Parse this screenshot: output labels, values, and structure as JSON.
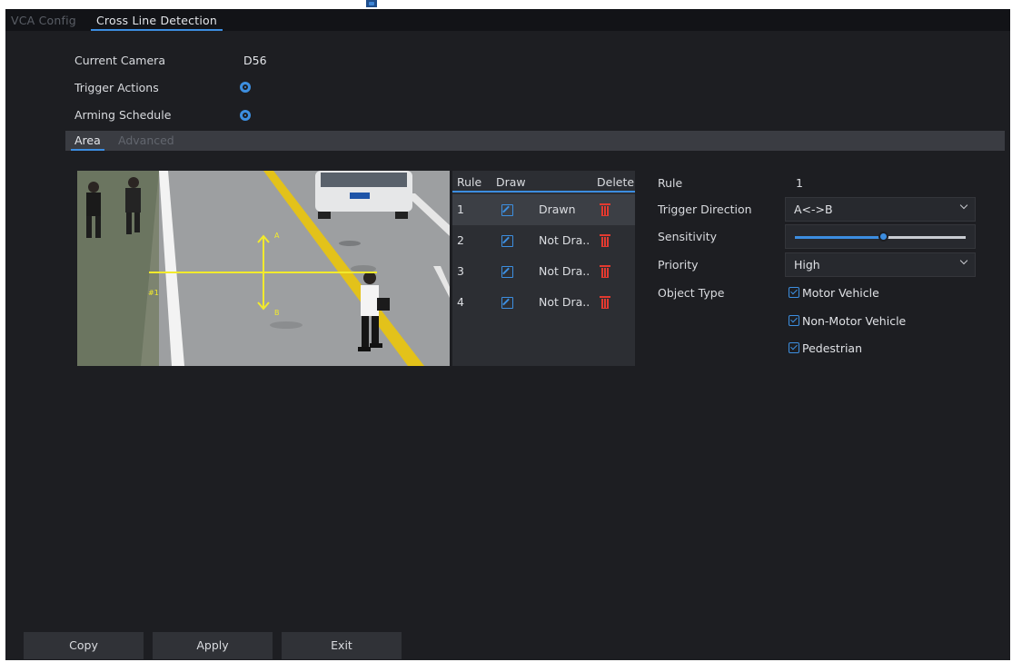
{
  "main_tabs": [
    {
      "label": "VCA Config",
      "active": false
    },
    {
      "label": "Cross Line Detection",
      "active": true
    }
  ],
  "info": {
    "current_camera_label": "Current Camera",
    "current_camera_value": "D56",
    "trigger_actions_label": "Trigger Actions",
    "arming_schedule_label": "Arming Schedule"
  },
  "sub_tabs": [
    {
      "label": "Area",
      "active": true
    },
    {
      "label": "Advanced",
      "active": false
    }
  ],
  "preview": {
    "marker_a": "A",
    "marker_b": "B",
    "line_label": "#1"
  },
  "rule_table": {
    "headers": {
      "rule": "Rule",
      "draw": "Draw",
      "delete": "Delete"
    },
    "rows": [
      {
        "number": "1",
        "status": "Drawn",
        "selected": true
      },
      {
        "number": "2",
        "status": "Not Dra..",
        "selected": false
      },
      {
        "number": "3",
        "status": "Not Dra..",
        "selected": false
      },
      {
        "number": "4",
        "status": "Not Dra..",
        "selected": false
      }
    ]
  },
  "properties": {
    "rule_label": "Rule",
    "rule_value": "1",
    "trigger_direction_label": "Trigger Direction",
    "trigger_direction_value": "A<->B",
    "sensitivity_label": "Sensitivity",
    "sensitivity_level_fraction": 0.52,
    "priority_label": "Priority",
    "priority_value": "High",
    "object_type_label": "Object Type",
    "object_types": [
      {
        "label": "Motor Vehicle",
        "checked": true
      },
      {
        "label": "Non-Motor Vehicle",
        "checked": true
      },
      {
        "label": "Pedestrian",
        "checked": true
      }
    ]
  },
  "footer": {
    "copy_label": "Copy",
    "apply_label": "Apply",
    "exit_label": "Exit"
  },
  "colors": {
    "accent": "#3c8de0",
    "delete_red": "#e23a30",
    "draw_line_yellow": "#f2ea2c",
    "background": "#1d1e22"
  },
  "icons": [
    "gear-icon",
    "edit-icon",
    "trash-icon",
    "chevron-down-icon",
    "checkbox-checked-icon"
  ]
}
